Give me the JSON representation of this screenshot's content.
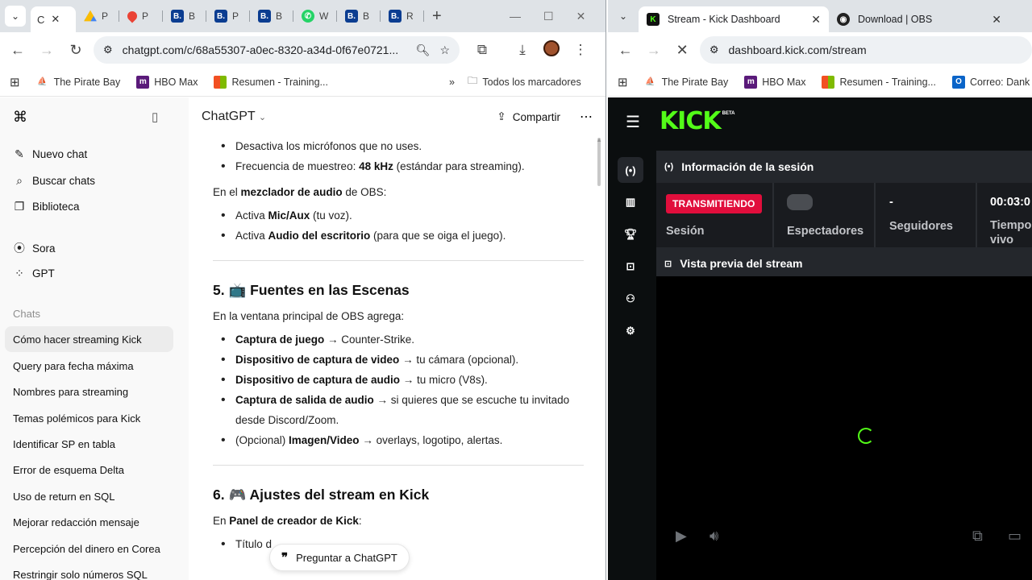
{
  "left_window": {
    "tabs": [
      {
        "title": "C",
        "favicon": "chatgpt-icon",
        "color": "#111111"
      },
      {
        "title": "P",
        "favicon": "google-drive-icon",
        "color": "#1a73e8"
      },
      {
        "title": "P",
        "favicon": "google-maps-icon",
        "color": "#34a853"
      },
      {
        "title": "B",
        "favicon": "b-icon",
        "color": "#0b3d91"
      },
      {
        "title": "P",
        "favicon": "b-icon",
        "color": "#0b3d91"
      },
      {
        "title": "B",
        "favicon": "b-icon",
        "color": "#0b3d91"
      },
      {
        "title": "W",
        "favicon": "whatsapp-icon",
        "color": "#25d366"
      },
      {
        "title": "B",
        "favicon": "b-icon",
        "color": "#0b3d91"
      },
      {
        "title": "R",
        "favicon": "b-icon",
        "color": "#0b3d91"
      }
    ],
    "url": "chatgpt.com/c/68a55307-a0ec-8320-a34d-0f67e0721...",
    "bookmarks": [
      "The Pirate Bay",
      "HBO Max",
      "Resumen - Training..."
    ],
    "all_bookmarks": "Todos los marcadores"
  },
  "chatgpt": {
    "sidebar_top": [
      "Nuevo chat",
      "Buscar chats",
      "Biblioteca"
    ],
    "sidebar_tools": [
      "Sora",
      "GPT"
    ],
    "chats_heading": "Chats",
    "chats": [
      "Cómo hacer streaming Kick",
      "Query para fecha máxima",
      "Nombres para streaming",
      "Temas polémicos para Kick",
      "Identificar SP en tabla",
      "Error de esquema Delta",
      "Uso de return en SQL",
      "Mejorar redacción mensaje",
      "Percepción del dinero en Corea",
      "Restringir solo números SQL"
    ],
    "model": "ChatGPT",
    "share": "Compartir",
    "content": {
      "b1": "Desactiva los micrófonos que no uses.",
      "b2_pre": "Frecuencia de muestreo: ",
      "b2_bold": "48 kHz",
      "b2_post": " (estándar para streaming).",
      "p1_pre": "En el ",
      "p1_bold": "mezclador de audio",
      "p1_post": " de OBS:",
      "b3_pre": "Activa ",
      "b3_bold": "Mic/Aux",
      "b3_post": " (tu voz).",
      "b4_pre": "Activa ",
      "b4_bold": "Audio del escritorio",
      "b4_post": " (para que se oiga el juego).",
      "h5_num": "5.",
      "h5_emoji": "📺",
      "h5_text": "Fuentes en las Escenas",
      "p2": "En la ventana principal de OBS agrega:",
      "s1_bold": "Captura de juego",
      "s1_post": " → Counter-Strike.",
      "s2_bold": "Dispositivo de captura de video",
      "s2_post": " → tu cámara (opcional).",
      "s3_bold": "Dispositivo de captura de audio",
      "s3_post": " → tu micro (V8s).",
      "s4_bold": "Captura de salida de audio",
      "s4_post": " → si quieres que se escuche tu invitado desde Discord/Zoom.",
      "s5_pre": "(Opcional) ",
      "s5_bold": "Imagen/Video",
      "s5_post": " → overlays, logotipo, alertas.",
      "h6_num": "6.",
      "h6_emoji": "🎮",
      "h6_text": "Ajustes del stream en Kick",
      "p3_pre": "En ",
      "p3_bold": "Panel de creador de Kick",
      "p3_post": ":",
      "t1": "Título d"
    },
    "ask_button": "Preguntar a ChatGPT"
  },
  "right_window": {
    "tabs": [
      {
        "title": "Stream - Kick Dashboard",
        "active": true
      },
      {
        "title": "Download | OBS",
        "active": false
      }
    ],
    "url": "dashboard.kick.com/stream",
    "bookmarks": [
      "The Pirate Bay",
      "HBO Max",
      "Resumen - Training...",
      "Correo: Dank H.I"
    ]
  },
  "kick": {
    "logo": "KICK",
    "logo_badge": "BETA",
    "session_title": "Información de la sesión",
    "live_badge": "TRANSMITIENDO",
    "session_label": "Sesión",
    "viewers_label": "Espectadores",
    "followers_value": "-",
    "followers_label": "Seguidores",
    "time_value": "00:03:0",
    "time_label": "Tiempo vivo",
    "preview_title": "Vista previa del stream",
    "accent": "#53fc18"
  }
}
